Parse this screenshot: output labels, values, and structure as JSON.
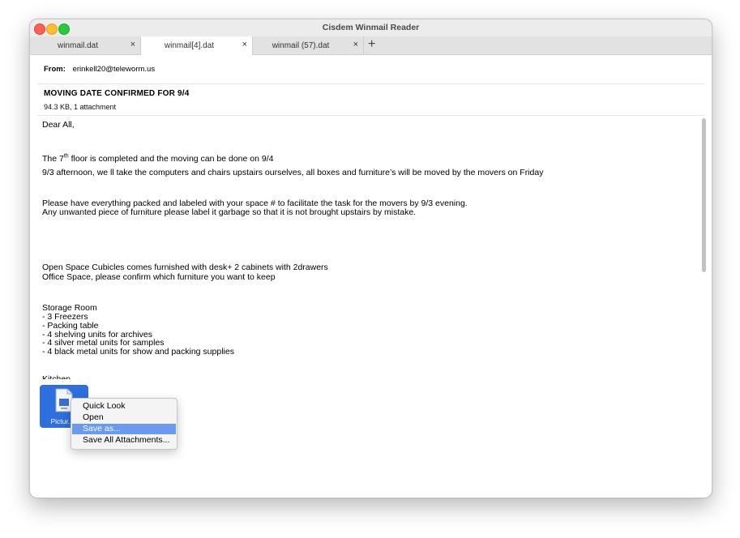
{
  "window": {
    "title": "Cisdem Winmail Reader"
  },
  "tabs": [
    {
      "label": "winmail.dat",
      "close": "×"
    },
    {
      "label": "winmail[4].dat",
      "close": "×"
    },
    {
      "label": "winmail (57).dat",
      "close": "×"
    }
  ],
  "tab_add": "+",
  "header": {
    "from_label": "From:",
    "from_value": "erinkell20@teleworm.us",
    "subject": "MOVING DATE CONFIRMED FOR 9/4",
    "meta": "94.3 KB, 1 attachment"
  },
  "body": {
    "greeting": "Dear All,",
    "floor_pre": "The 7",
    "floor_sup": "th",
    "floor_post": " floor is completed and the moving can be done on 9/4",
    "afternoon": "9/3 afternoon, we ll take the computers and chairs upstairs ourselves, all boxes and   furniture’s will be moved by the movers on Friday",
    "pack": "Please have everything packed and labeled with your space # to facilitate the task for the movers by 9/3 evening.",
    "unwanted": "Any unwanted piece of furniture please label it garbage so that it is not brought upstairs by mistake.",
    "cubicles": "Open Space Cubicles comes furnished with desk+ 2 cabinets with 2drawers",
    "office": "Office Space, please confirm which furniture you want to keep",
    "storage_title": "Storage Room",
    "storage_items": [
      "- 3 Freezers",
      "- Packing table",
      "- 4 shelving units for archives",
      "- 4 silver metal units for samples",
      "- 4 black metal units for show and packing supplies"
    ],
    "partial": "Kitchen"
  },
  "attachment": {
    "name": "Pictur...p",
    "icon": "document-icon"
  },
  "context_menu": {
    "items": [
      "Quick Look",
      "Open",
      "Save as...",
      "Save All Attachments..."
    ],
    "selected_index": 2
  },
  "colors": {
    "selection": "#6a99ef",
    "attachment_bg": "#2d6fdf",
    "close_btn": "#fe5f57",
    "minimize_btn": "#febc2e",
    "zoom_btn": "#28c840"
  }
}
